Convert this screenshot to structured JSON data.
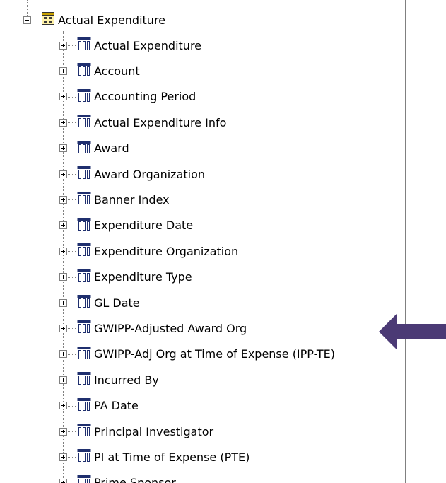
{
  "tree": {
    "root": {
      "label": "Actual Expenditure",
      "expanded": true,
      "icon": "folder-table-icon"
    },
    "children": [
      {
        "label": "Actual Expenditure",
        "icon": "dimension-columns-icon",
        "expanded": false
      },
      {
        "label": "Account",
        "icon": "dimension-columns-icon",
        "expanded": false
      },
      {
        "label": "Accounting Period",
        "icon": "dimension-columns-icon",
        "expanded": false
      },
      {
        "label": "Actual Expenditure Info",
        "icon": "dimension-columns-icon",
        "expanded": false
      },
      {
        "label": "Award",
        "icon": "dimension-columns-icon",
        "expanded": false
      },
      {
        "label": "Award Organization",
        "icon": "dimension-columns-icon",
        "expanded": false
      },
      {
        "label": "Banner Index",
        "icon": "dimension-columns-icon",
        "expanded": false
      },
      {
        "label": "Expenditure Date",
        "icon": "dimension-columns-icon",
        "expanded": false
      },
      {
        "label": "Expenditure Organization",
        "icon": "dimension-columns-icon",
        "expanded": false
      },
      {
        "label": "Expenditure Type",
        "icon": "dimension-columns-icon",
        "expanded": false
      },
      {
        "label": "GL Date",
        "icon": "dimension-columns-icon",
        "expanded": false
      },
      {
        "label": "GWIPP-Adjusted Award Org",
        "icon": "dimension-columns-icon",
        "expanded": false
      },
      {
        "label": "GWIPP-Adj Org at Time of Expense (IPP-TE)",
        "icon": "dimension-columns-icon",
        "expanded": false
      },
      {
        "label": "Incurred By",
        "icon": "dimension-columns-icon",
        "expanded": false
      },
      {
        "label": "PA Date",
        "icon": "dimension-columns-icon",
        "expanded": false
      },
      {
        "label": "Principal Investigator",
        "icon": "dimension-columns-icon",
        "expanded": false
      },
      {
        "label": "PI at Time of Expense (PTE)",
        "icon": "dimension-columns-icon",
        "expanded": false
      },
      {
        "label": "Prime Sponsor",
        "icon": "dimension-columns-icon",
        "expanded": false
      }
    ]
  },
  "annotation": {
    "icon": "left-arrow-icon",
    "color": "#4b3a75",
    "points_to": "GWIPP-Adjusted Award Org"
  },
  "colors": {
    "panel_border": "#808080",
    "connector": "#808080",
    "folder_icon": "#c8a000",
    "columns_icon": "#1f2f6e"
  }
}
